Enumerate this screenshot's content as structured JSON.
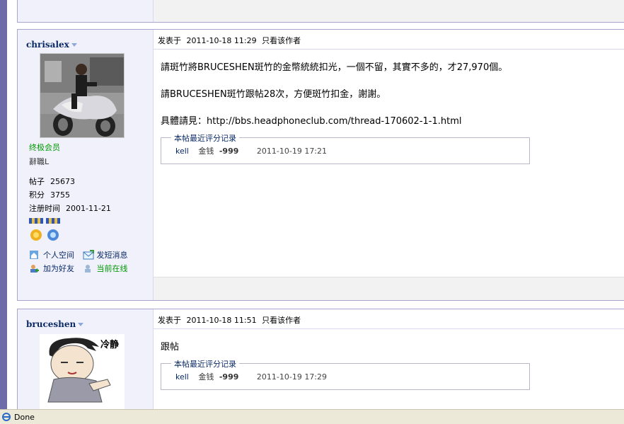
{
  "top_section": {
    "note": ""
  },
  "posts": [
    {
      "author": "chrisalex",
      "group": "终极会员",
      "title": "辭職L",
      "stats": [
        {
          "label": "帖子",
          "value": "25673"
        },
        {
          "label": "积分",
          "value": "3755"
        },
        {
          "label": "注册时间",
          "value": "2001-11-21"
        }
      ],
      "links": [
        {
          "label": "个人空间",
          "icon": "home-icon"
        },
        {
          "label": "发短消息",
          "icon": "message-icon"
        },
        {
          "label": "加为好友",
          "icon": "add-friend-icon"
        },
        {
          "label": "当前在线",
          "icon": "online-icon"
        }
      ],
      "posted_prefix": "发表于",
      "posted_time": "2011-10-18 11:29",
      "only_author": "只看该作者",
      "body": [
        "請斑竹將BRUCESHEN斑竹的金幣統統扣光，一個不留，其實不多的，才27,970個。",
        "請BRUCESHEN斑竹跟帖28次，方便斑竹扣金，謝謝。",
        "具體請見：http://bbs.headphoneclub.com/thread-170602-1-1.html"
      ],
      "rating": {
        "legend": "本帖最近评分记录",
        "user": "kell",
        "field": "金钱",
        "amount": "-999",
        "time": "2011-10-19 17:21"
      }
    },
    {
      "author": "bruceshen",
      "posted_prefix": "发表于",
      "posted_time": "2011-10-18 11:51",
      "only_author": "只看该作者",
      "body": [
        "跟帖"
      ],
      "avatar_caption": "冷静",
      "rating": {
        "legend": "本帖最近评分记录",
        "user": "kell",
        "field": "金钱",
        "amount": "-999",
        "time": "2011-10-19 17:29"
      }
    }
  ],
  "statusbar": {
    "text": "Done"
  }
}
